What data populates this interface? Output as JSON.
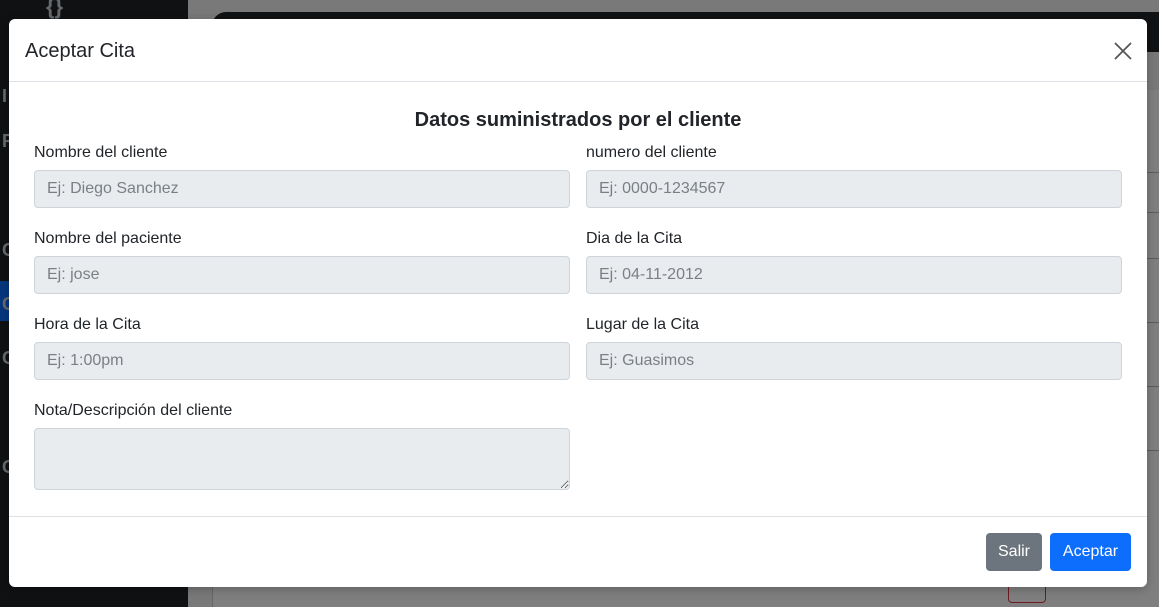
{
  "modal": {
    "title": "Aceptar Cita",
    "section_title": "Datos suministrados por el cliente",
    "fields": {
      "client_name": {
        "label": "Nombre del cliente",
        "placeholder": "Ej: Diego Sanchez",
        "value": ""
      },
      "client_number": {
        "label": "numero del cliente",
        "placeholder": "Ej: 0000-1234567",
        "value": ""
      },
      "patient_name": {
        "label": "Nombre del paciente",
        "placeholder": "Ej: jose",
        "value": ""
      },
      "appointment_day": {
        "label": "Dia de la Cita",
        "placeholder": "Ej: 04-11-2012",
        "value": ""
      },
      "appointment_time": {
        "label": "Hora de la Cita",
        "placeholder": "Ej: 1:00pm",
        "value": ""
      },
      "appointment_place": {
        "label": "Lugar de la Cita",
        "placeholder": "Ej: Guasimos",
        "value": ""
      },
      "client_note": {
        "label": "Nota/Descripción del cliente",
        "value": ""
      }
    },
    "buttons": {
      "exit_label": "Salir",
      "accept_label": "Aceptar"
    }
  },
  "background": {
    "sidebar_letters": [
      "I",
      "R",
      "C",
      "Ci",
      "C",
      "C"
    ]
  },
  "colors": {
    "primary": "#0d6efd",
    "secondary": "#6c757d",
    "input_bg": "#e9ecef",
    "sidebar_bg": "#1f2327"
  }
}
